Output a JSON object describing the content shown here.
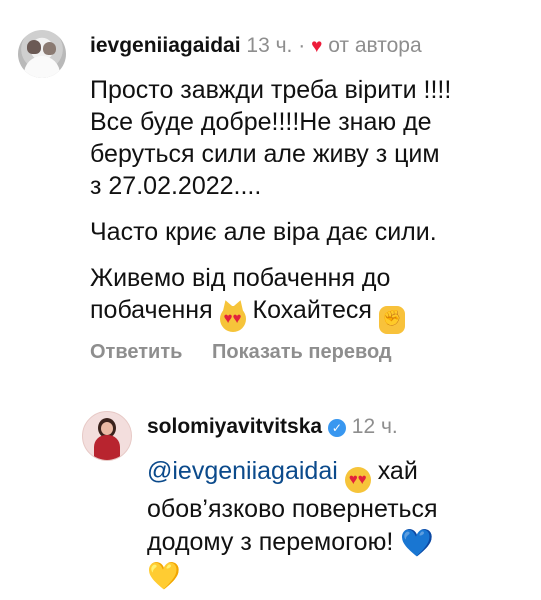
{
  "comment1": {
    "username": "ievgeniiagaidai",
    "time": "13 ч.",
    "dot": "·",
    "liked_by_author": "от автора",
    "paragraphs": [
      "Просто завжди треба вірити !!!!\nВсе буде добре!!!!Не знаю де\nберуться сили але живу з цим\nз 27.02.2022....",
      "Часто криє але віра дає сили."
    ],
    "last_para_a": "Живемо від побачення до\nпобачення ",
    "last_para_b": " Кохайтеся ",
    "actions": {
      "reply": "Ответить",
      "translate": "Показать перевод"
    }
  },
  "comment2": {
    "username": "solomiyavitvitska",
    "time": "12 ч.",
    "mention": "@ievgeniiagaidai",
    "text_a": " хай\nобов’язково повернеться\nдодому з перемогою! ",
    "emoji_blue_heart": "💙",
    "emoji_yellow_heart": "💛"
  },
  "icons": {
    "heart": "♥",
    "verified_check": "✓",
    "smile_hearts": "♥♥",
    "fist": "✊",
    "cat_hearts": "♥♥"
  },
  "colors": {
    "meta_gray": "#8e8e8e",
    "like_red": "#ed1c3a",
    "mention_blue": "#0b4a8b",
    "verified_blue": "#3897f0"
  }
}
